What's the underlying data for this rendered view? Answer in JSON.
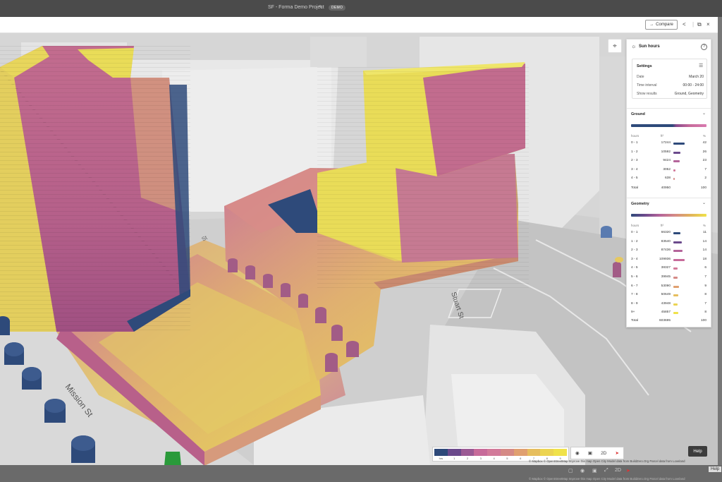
{
  "window": {
    "title": "SF - Forma Demo Project",
    "badge": "DEMO"
  },
  "toolbar": {
    "compare_label": "Compare"
  },
  "panel": {
    "title": "Sun hours",
    "settings": {
      "heading": "Settings",
      "rows": [
        {
          "label": "Date",
          "value": "March 20"
        },
        {
          "label": "Time interval",
          "value": "00:00 - 24:00"
        },
        {
          "label": "Show results",
          "value": "Ground, Geometry"
        }
      ]
    },
    "ground": {
      "label": "Ground",
      "col_hours": "hours",
      "col_area": "ft²",
      "col_pct": "%",
      "rows": [
        {
          "hours": "0 - 1",
          "area": "17244",
          "pct": "42",
          "color": "#2e4a7a"
        },
        {
          "hours": "1 - 2",
          "area": "10592",
          "pct": "26",
          "color": "#6b4a8c"
        },
        {
          "hours": "2 - 3",
          "area": "9424",
          "pct": "23",
          "color": "#b4649a"
        },
        {
          "hours": "3 - 4",
          "area": "3052",
          "pct": "7",
          "color": "#d27a9a"
        },
        {
          "hours": "4 - 5",
          "area": "638",
          "pct": "2",
          "color": "#d58a86"
        }
      ],
      "total_label": "Total",
      "total_area": "40950",
      "total_pct": "100"
    },
    "geometry": {
      "label": "Geometry",
      "col_hours": "hours",
      "col_area": "ft²",
      "col_pct": "%",
      "rows": [
        {
          "hours": "0 - 1",
          "area": "66320",
          "pct": "11",
          "color": "#2e4a7a"
        },
        {
          "hours": "1 - 2",
          "area": "83540",
          "pct": "14",
          "color": "#6b4a8c"
        },
        {
          "hours": "2 - 3",
          "area": "87436",
          "pct": "14",
          "color": "#b4649a"
        },
        {
          "hours": "3 - 4",
          "area": "109936",
          "pct": "18",
          "color": "#c76b9a"
        },
        {
          "hours": "4 - 5",
          "area": "38327",
          "pct": "6",
          "color": "#d27a9a"
        },
        {
          "hours": "5 - 6",
          "area": "39945",
          "pct": "7",
          "color": "#d58a86"
        },
        {
          "hours": "6 - 7",
          "area": "53090",
          "pct": "9",
          "color": "#e0a070"
        },
        {
          "hours": "7 - 8",
          "area": "50649",
          "pct": "8",
          "color": "#e6be5e"
        },
        {
          "hours": "8 - 9",
          "area": "43948",
          "pct": "7",
          "color": "#ecd452"
        },
        {
          "hours": "9+",
          "area": "45857",
          "pct": "8",
          "color": "#f0e24a"
        }
      ],
      "total_label": "Total",
      "total_area": "603695",
      "total_pct": "100"
    }
  },
  "legend": {
    "labels": [
      "hrs",
      "1",
      "2",
      "3",
      "4",
      "5",
      "6",
      "7",
      "8",
      "9"
    ],
    "colors": [
      "#2e4a7a",
      "#6b4a8c",
      "#9b5a94",
      "#c76b9a",
      "#d27a9a",
      "#d58a86",
      "#e0a070",
      "#e6be5e",
      "#ecd452",
      "#f0e24a"
    ]
  },
  "viewtools": {
    "mode_label": "2D"
  },
  "help_label": "Help",
  "map_labels": {
    "mission": "Mission St",
    "stuart": "Stuart St",
    "street3": "St"
  },
  "attribution": "© Mapbox © OpenStreetMap Improve this map Open City Model data from BuildZero.Org Parcel data from Loveland",
  "attribution_ghost": "© Mapbox © OpenStreetMap Improve this map Open City Model data from BuildZero.Org Parcel data from Loveland"
}
